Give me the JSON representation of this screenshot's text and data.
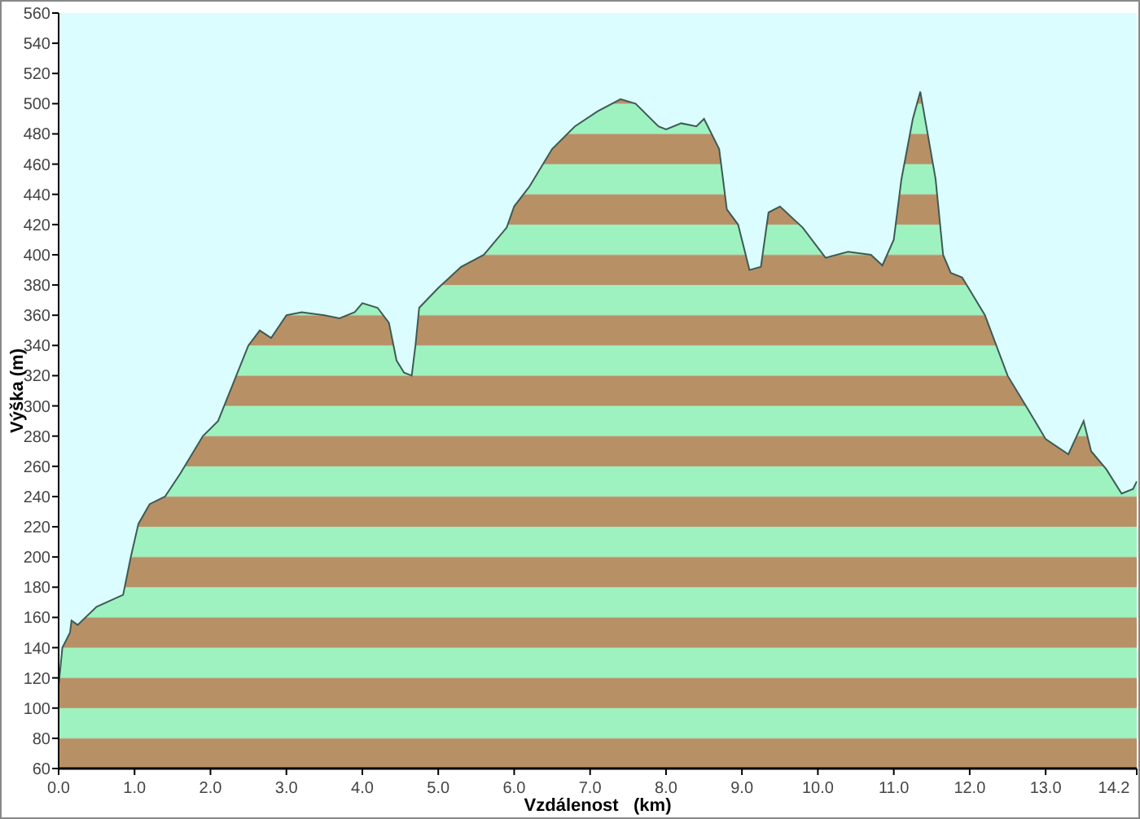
{
  "chart_data": {
    "type": "area",
    "xlabel": "Vzdálenost   (km)",
    "ylabel": "Výška (m)",
    "xlim": [
      0,
      14.2
    ],
    "ylim": [
      60,
      560
    ],
    "xticks": [
      {
        "value": 0,
        "label": "0.0"
      },
      {
        "value": 1,
        "label": "1.0"
      },
      {
        "value": 2,
        "label": "2.0"
      },
      {
        "value": 3,
        "label": "3.0"
      },
      {
        "value": 4,
        "label": "4.0"
      },
      {
        "value": 5,
        "label": "5.0"
      },
      {
        "value": 6,
        "label": "6.0"
      },
      {
        "value": 7,
        "label": "7.0"
      },
      {
        "value": 8,
        "label": "8.0"
      },
      {
        "value": 9,
        "label": "9.0"
      },
      {
        "value": 10,
        "label": "10.0"
      },
      {
        "value": 11,
        "label": "11.0"
      },
      {
        "value": 12,
        "label": "12.0"
      },
      {
        "value": 13,
        "label": "13.0"
      },
      {
        "value": 14.2,
        "label": "14.2"
      }
    ],
    "yticks": [
      60,
      80,
      100,
      120,
      140,
      160,
      180,
      200,
      220,
      240,
      260,
      280,
      300,
      320,
      340,
      360,
      380,
      400,
      420,
      440,
      460,
      480,
      500,
      520,
      540,
      560
    ],
    "x": [
      0,
      0.05,
      0.15,
      0.17,
      0.25,
      0.5,
      0.85,
      0.95,
      1.05,
      1.2,
      1.4,
      1.6,
      1.9,
      2.1,
      2.3,
      2.5,
      2.65,
      2.8,
      3.0,
      3.2,
      3.5,
      3.7,
      3.9,
      4.0,
      4.2,
      4.35,
      4.45,
      4.55,
      4.65,
      4.7,
      4.75,
      5.0,
      5.3,
      5.6,
      5.9,
      6.0,
      6.2,
      6.5,
      6.8,
      7.1,
      7.4,
      7.6,
      7.9,
      8.0,
      8.2,
      8.4,
      8.5,
      8.7,
      8.8,
      8.95,
      9.1,
      9.25,
      9.35,
      9.5,
      9.8,
      10.1,
      10.4,
      10.7,
      10.85,
      11.0,
      11.1,
      11.25,
      11.35,
      11.55,
      11.65,
      11.75,
      11.9,
      12.2,
      12.5,
      12.8,
      13.0,
      13.3,
      13.5,
      13.6,
      13.8,
      14.0,
      14.15,
      14.2
    ],
    "values": [
      115,
      140,
      150,
      158,
      155,
      167,
      175,
      200,
      222,
      235,
      240,
      255,
      280,
      290,
      315,
      340,
      350,
      345,
      360,
      362,
      360,
      358,
      362,
      368,
      365,
      355,
      330,
      322,
      320,
      340,
      365,
      378,
      392,
      400,
      418,
      432,
      445,
      470,
      485,
      495,
      503,
      500,
      485,
      483,
      487,
      485,
      490,
      470,
      430,
      420,
      390,
      392,
      428,
      432,
      418,
      398,
      402,
      400,
      393,
      410,
      450,
      490,
      508,
      450,
      400,
      388,
      385,
      360,
      320,
      295,
      278,
      268,
      290,
      270,
      258,
      242,
      245,
      250
    ]
  }
}
